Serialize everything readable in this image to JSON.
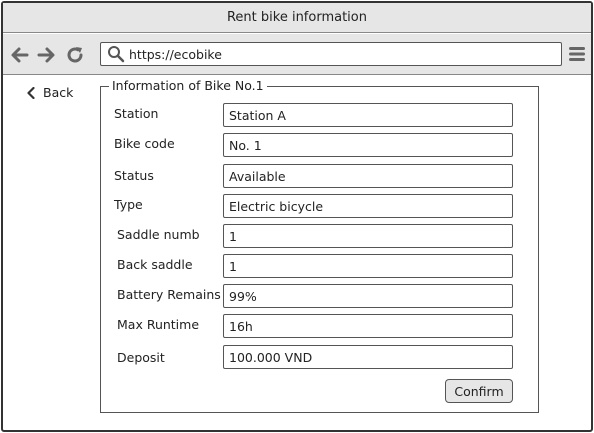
{
  "window": {
    "title": "Rent bike information"
  },
  "toolbar": {
    "url": "https://ecobike",
    "icons": [
      "back-arrow-icon",
      "forward-arrow-icon",
      "reload-icon",
      "search-icon",
      "menu-icon"
    ]
  },
  "nav": {
    "back_label": "Back"
  },
  "form": {
    "legend": "Information of Bike No.1",
    "fields": [
      {
        "label": "Station",
        "value": "Station A"
      },
      {
        "label": "Bike code",
        "value": "No. 1"
      },
      {
        "label": "Status",
        "value": "Available"
      },
      {
        "label": "Type",
        "value": "Electric bicycle"
      },
      {
        "label": "Saddle numb",
        "value": "1"
      },
      {
        "label": "Back saddle",
        "value": "1"
      },
      {
        "label": "Battery Remains",
        "value": "99%"
      },
      {
        "label": "Max Runtime",
        "value": "16h"
      },
      {
        "label": "Deposit",
        "value": "100.000 VND"
      }
    ],
    "confirm_label": "Confirm"
  }
}
